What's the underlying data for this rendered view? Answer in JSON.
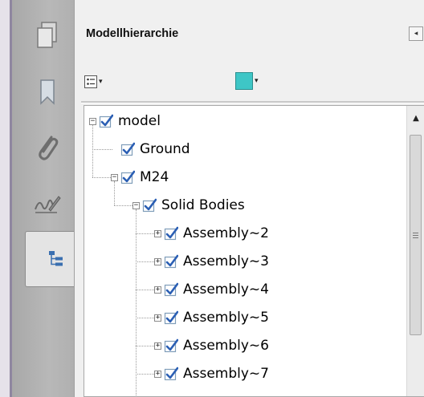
{
  "panel": {
    "title": "Modellhierarchie",
    "collapse_glyph": "◂",
    "options_caret": "▾",
    "color_caret": "▾",
    "color": "#3ec6c6"
  },
  "rail": {
    "items": [
      {
        "icon": "pages-icon"
      },
      {
        "icon": "bookmark-icon"
      },
      {
        "icon": "attachment-icon"
      },
      {
        "icon": "signature-icon"
      },
      {
        "icon": "model-tree-icon",
        "active": true
      }
    ]
  },
  "tree": {
    "nodes": [
      {
        "label": "model",
        "toggle": "−"
      },
      {
        "label": "Ground",
        "toggle": ""
      },
      {
        "label": "M24",
        "toggle": "−"
      },
      {
        "label": "Solid Bodies",
        "toggle": "−"
      },
      {
        "label": "Assembly~2",
        "toggle": "+"
      },
      {
        "label": "Assembly~3",
        "toggle": "+"
      },
      {
        "label": "Assembly~4",
        "toggle": "+"
      },
      {
        "label": "Assembly~5",
        "toggle": "+"
      },
      {
        "label": "Assembly~6",
        "toggle": "+"
      },
      {
        "label": "Assembly~7",
        "toggle": "+"
      }
    ]
  },
  "scrollbar": {
    "up_glyph": "▲"
  }
}
